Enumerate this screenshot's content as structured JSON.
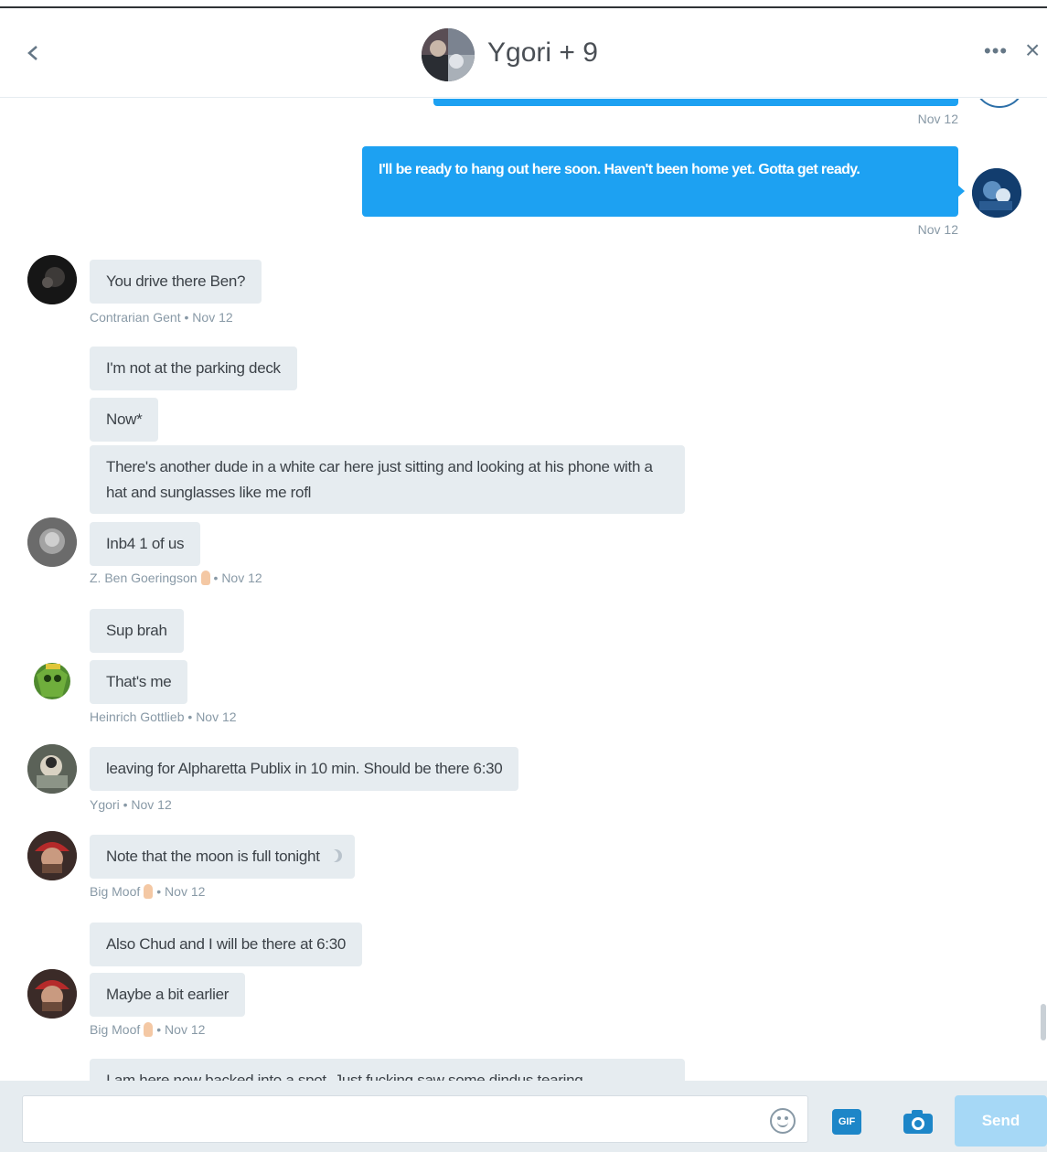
{
  "header": {
    "back_label": "‹",
    "title": "Ygori + 9",
    "more_label": "•••",
    "close_label": "×"
  },
  "messages": {
    "prev_time": "Nov 12",
    "sent1_text": "I'll be ready to hang out here soon. Haven't been home yet. Gotta get ready.",
    "sent1_time": "Nov 12",
    "m1_text": "You drive there Ben?",
    "m1_author": "Contrarian Gent",
    "m1_time": "Nov 12",
    "m2_text": "I'm not at the parking deck",
    "m3_text": "Now*",
    "m4_text": "There's another dude in a white car here just sitting and looking at his phone with a hat and sunglasses like me rofl",
    "m5_text": "Inb4 1 of us",
    "m5_author": "Z. Ben Goeringson",
    "m5_time": "Nov 12",
    "m6_text": "Sup brah",
    "m7_text": "That's me",
    "m7_author": "Heinrich Gottlieb",
    "m7_time": "Nov 12",
    "m8_text": "leaving for Alpharetta Publix in 10 min. Should be there 6:30",
    "m8_author": "Ygori",
    "m8_time": "Nov 12",
    "m9_text": "Note that the moon is full tonight",
    "m9_author": "Big Moof",
    "m9_time": "Nov 12",
    "m10_text": "Also Chud and I will be there at 6:30",
    "m11_text": "Maybe a bit earlier",
    "m11_author": "Big Moof",
    "m11_time": "Nov 12",
    "m12_text": "I am here now backed into a spot. Just fucking saw some dindus tearing"
  },
  "composer": {
    "placeholder": "",
    "gif_label": "GIF",
    "send_label": "Send"
  },
  "icons": {
    "back": "chevron-left-icon",
    "more": "more-icon",
    "close": "close-icon",
    "emoji": "smiley-icon",
    "gif": "gif-icon",
    "camera": "camera-icon"
  },
  "colors": {
    "accent": "#1da1f2",
    "received_bubble": "#e6ecf0",
    "meta_text": "#8899a6",
    "send_button_disabled": "#a6d8f6"
  }
}
